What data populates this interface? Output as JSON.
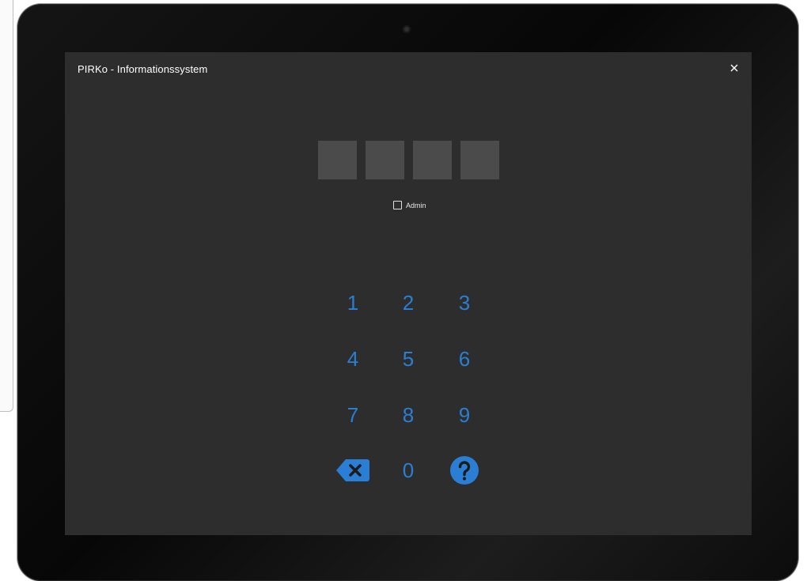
{
  "window": {
    "title": "PIRKo - Informationssystem",
    "close_icon": "close-icon"
  },
  "pin": {
    "length": 4
  },
  "admin": {
    "label": "Admin",
    "checked": false
  },
  "keypad": {
    "keys": [
      "1",
      "2",
      "3",
      "4",
      "5",
      "6",
      "7",
      "8",
      "9",
      "0"
    ],
    "backspace_icon": "backspace-icon",
    "help_icon": "help-icon",
    "accent_color": "#2a7fd4"
  },
  "colors": {
    "screen_bg": "#2d2d2d",
    "pin_box": "#4b4b4b",
    "title_text": "#ffffff"
  }
}
